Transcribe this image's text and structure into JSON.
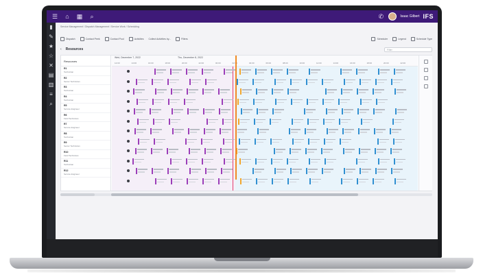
{
  "topbar": {
    "user_name": "Isaac Gilbert",
    "brand": "IFS",
    "icons": [
      "menu-icon",
      "home-icon",
      "grid-icon",
      "search-icon",
      "phone-icon"
    ]
  },
  "sidenav": {
    "icons": [
      "bookmark-icon",
      "edit-icon",
      "star-icon",
      "star-outline-icon",
      "tools-icon",
      "document-icon",
      "calendar-icon",
      "layers-icon",
      "search-icon"
    ]
  },
  "breadcrumb": "Service Management / Dispatch Management / Service Work / Scheduling",
  "toolbar": {
    "items": [
      "Dispatch",
      "Contact Peek",
      "Contact Pool",
      "Activities",
      "Collect Activities by...",
      "Filters",
      "Scheduler",
      "Legend",
      "Schedule Type"
    ]
  },
  "resources_bar": {
    "title": "Resources",
    "search_placeholder": "Filter"
  },
  "resources_header": "Resources",
  "resources": [
    {
      "name": "R1",
      "sub": "Technician"
    },
    {
      "name": "R2",
      "sub": "Senior Technician"
    },
    {
      "name": "R3",
      "sub": "Technician"
    },
    {
      "name": "R4",
      "sub": "Technician"
    },
    {
      "name": "R5",
      "sub": "Service Engineer"
    },
    {
      "name": "R6",
      "sub": "Field Technician"
    },
    {
      "name": "R7",
      "sub": "Service Engineer"
    },
    {
      "name": "R8",
      "sub": "Technician"
    },
    {
      "name": "R9",
      "sub": "Senior Technician"
    },
    {
      "name": "R10",
      "sub": "Field Technician"
    },
    {
      "name": "R11",
      "sub": "Technician"
    },
    {
      "name": "R12",
      "sub": "Service Engineer"
    }
  ],
  "timeline": {
    "day1": "Wed, December 7, 2022",
    "day2": "Thu, December 8, 2022",
    "hours": [
      "12:00",
      "14:00",
      "16:00",
      "18:00",
      "20:00",
      "22:00",
      "00:00",
      "02:00",
      "04:00",
      "06:00",
      "08:00",
      "10:00",
      "12:00",
      "14:00",
      "16:00",
      "18:00",
      "20:00",
      "22:00"
    ]
  },
  "colors": {
    "topbar": "#3e1a78",
    "past_task": "#9b3db8",
    "current_task": "#f2a62b",
    "future_task": "#2f8fd1",
    "now_line": "#f08a24"
  }
}
